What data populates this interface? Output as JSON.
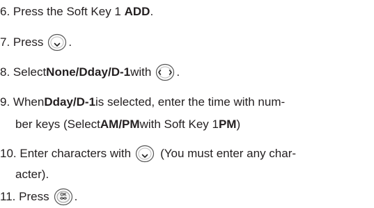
{
  "steps": [
    {
      "num": "6.",
      "pre": "Press the Soft Key 1 ",
      "bold": "ADD",
      "post": "."
    },
    {
      "num": "7.",
      "pre": "Press",
      "post": "."
    },
    {
      "num": "8.",
      "pre": "Select ",
      "bold": "None/Dday/D-1",
      "mid": " with",
      "post": "."
    },
    {
      "num": "9.",
      "pre": "When ",
      "bold": "Dday/D-1",
      "mid": " is selected, enter the time with num-",
      "line2_pre": "ber keys (Select ",
      "line2_bold1": "AM/PM",
      "line2_mid": " with Soft Key 1 ",
      "line2_bold2": "PM",
      "line2_post": ")"
    },
    {
      "num": "10.",
      "pre": "Enter characters with",
      "post": "(You must enter any char-",
      "line2": "acter)."
    },
    {
      "num": "11.",
      "pre": "Press",
      "post": "."
    }
  ],
  "icons": {
    "down": "navigation-down-key-icon",
    "leftright": "navigation-left-right-key-icon",
    "ok": "ok-key-icon",
    "ok_label": "OK"
  }
}
